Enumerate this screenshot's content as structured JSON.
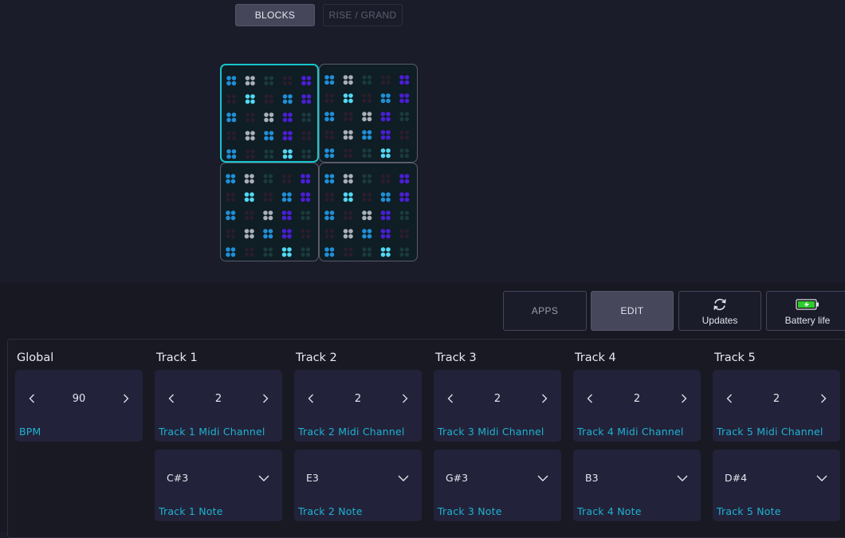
{
  "mode_tabs": {
    "blocks": "BLOCKS",
    "rise_grand": "RISE / GRAND"
  },
  "header_buttons": {
    "apps": "APPS",
    "edit": "EDIT",
    "updates": "Updates",
    "battery": "Battery life"
  },
  "icons": {
    "updates": "refresh-icon",
    "battery": "battery-charging-icon",
    "prev": "chevron-left-icon",
    "next": "chevron-right-icon",
    "dropdown": "chevron-down-icon"
  },
  "colors": {
    "accent": "#17c6cc",
    "label": "#1fb2d2",
    "battery_fill": "#2ecc2e",
    "pad_blue": "#1f8fd6",
    "pad_cyan": "#52d8f2",
    "pad_grey": "#aab0b8",
    "pad_violet": "#4a1ed6"
  },
  "blocks": {
    "count": 4,
    "selected_index": 0
  },
  "columns": [
    {
      "title": "Global",
      "stepper": {
        "value": "90",
        "label": "BPM"
      }
    },
    {
      "title": "Track 1",
      "stepper": {
        "value": "2",
        "label": "Track 1 Midi Channel"
      },
      "note": {
        "value": "C#3",
        "label": "Track 1 Note"
      }
    },
    {
      "title": "Track 2",
      "stepper": {
        "value": "2",
        "label": "Track 2 Midi Channel"
      },
      "note": {
        "value": "E3",
        "label": "Track 2 Note"
      }
    },
    {
      "title": "Track 3",
      "stepper": {
        "value": "2",
        "label": "Track 3 Midi Channel"
      },
      "note": {
        "value": "G#3",
        "label": "Track 3 Note"
      }
    },
    {
      "title": "Track 4",
      "stepper": {
        "value": "2",
        "label": "Track 4 Midi Channel"
      },
      "note": {
        "value": "B3",
        "label": "Track 4 Note"
      }
    },
    {
      "title": "Track 5",
      "stepper": {
        "value": "2",
        "label": "Track 5 Midi Channel"
      },
      "note": {
        "value": "D#4",
        "label": "Track 5 Note"
      }
    }
  ]
}
